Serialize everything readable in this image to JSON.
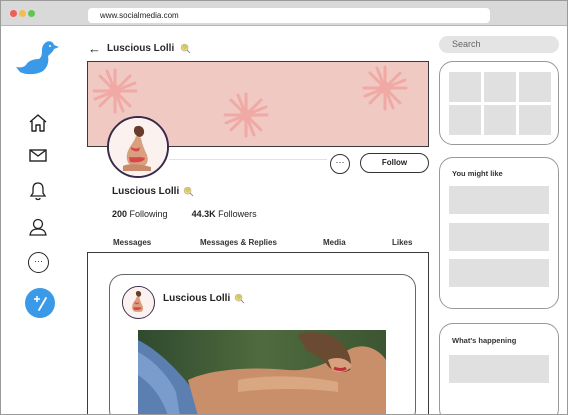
{
  "browser": {
    "url": "www.socialmedia.com",
    "traffic_lights": [
      "#ec5f56",
      "#f4be4f",
      "#61c454"
    ]
  },
  "nav": {
    "logo": "duck-logo-icon",
    "items": [
      {
        "name": "home-icon"
      },
      {
        "name": "mail-icon"
      },
      {
        "name": "bell-icon"
      },
      {
        "name": "profile-icon"
      },
      {
        "name": "more-icon",
        "label": "···"
      }
    ],
    "compose": {
      "name": "compose-icon",
      "label": "+/",
      "color": "#3b9ae8"
    }
  },
  "profile": {
    "back_arrow": "←",
    "header_name": "Luscious Lolli",
    "name": "Luscious Lolli",
    "following_count": "200",
    "following_label": "Following",
    "followers_count": "44.3K",
    "followers_label": "Followers",
    "more_label": "···",
    "follow_label": "Follow",
    "banner_color": "#f1c9c3",
    "tabs": [
      "Messages",
      "Messages & Replies",
      "Media",
      "Likes"
    ]
  },
  "post": {
    "author": "Luscious Lolli"
  },
  "sidebar": {
    "search_placeholder": "Search",
    "you_might_like": "You might like",
    "whats_happening": "What's happening"
  }
}
